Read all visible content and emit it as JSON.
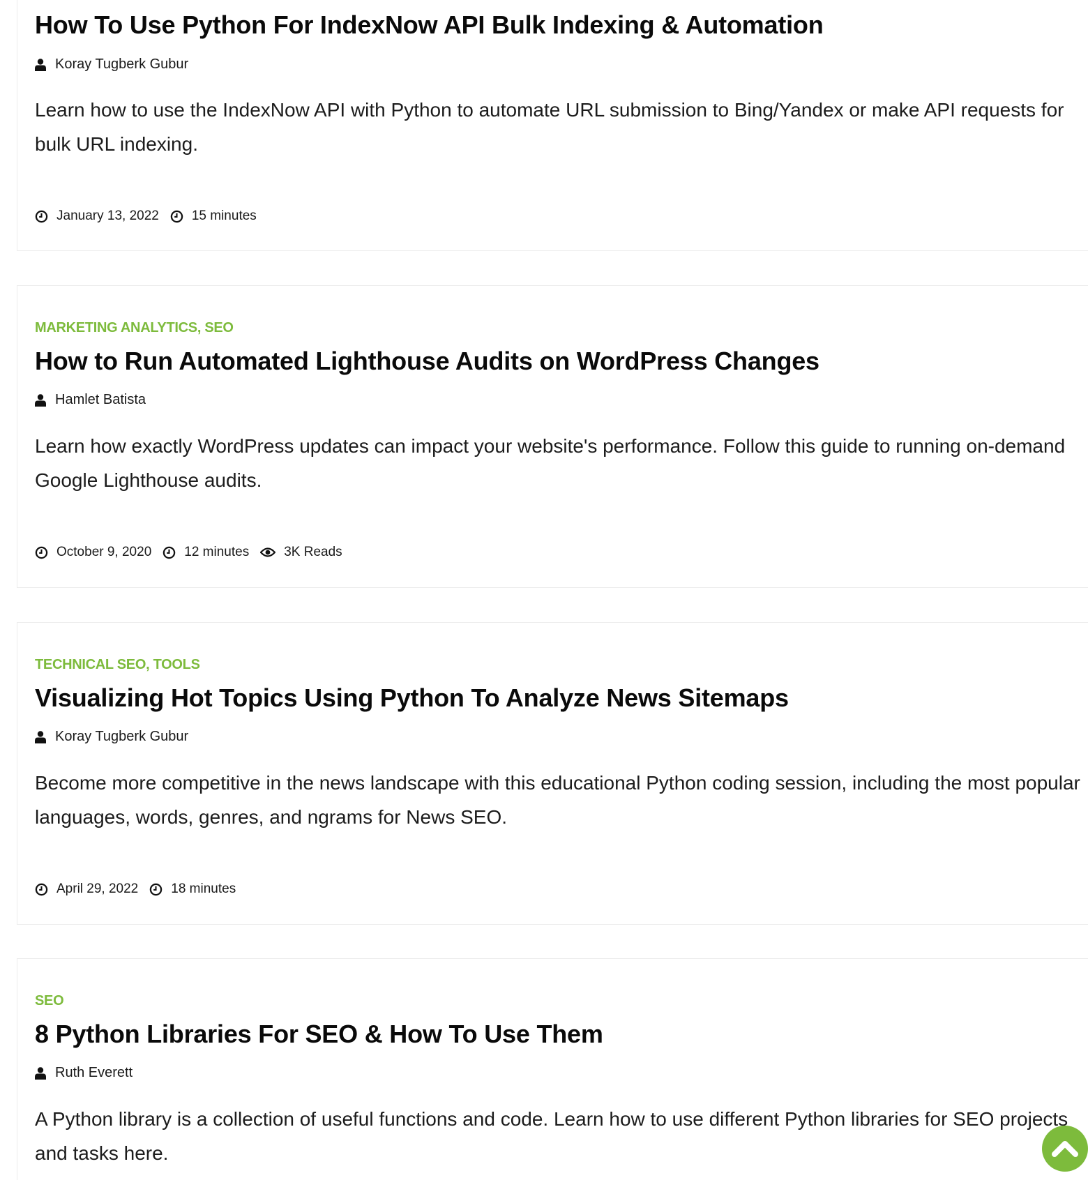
{
  "colors": {
    "accent": "#7dbb3c",
    "text": "#0a0a0a",
    "border": "#ececec"
  },
  "posts": [
    {
      "category": "",
      "title": "How To Use Python For IndexNow API Bulk Indexing & Automation",
      "author": "Koray Tugberk Gubur",
      "excerpt": "Learn how to use the IndexNow API with Python to automate URL submission to Bing/Yandex or make API requests for bulk URL indexing.",
      "date": "January 13, 2022",
      "read_time": "15 minutes",
      "reads": ""
    },
    {
      "category": "MARKETING ANALYTICS, SEO",
      "title": "How to Run Automated Lighthouse Audits on WordPress Changes",
      "author": "Hamlet Batista",
      "excerpt": "Learn how exactly WordPress updates can impact your website's performance. Follow this guide to running on-demand Google Lighthouse audits.",
      "date": "October 9, 2020",
      "read_time": "12 minutes",
      "reads": "3K Reads"
    },
    {
      "category": "TECHNICAL SEO, TOOLS",
      "title": "Visualizing Hot Topics Using Python To Analyze News Sitemaps",
      "author": "Koray Tugberk Gubur",
      "excerpt": "Become more competitive in the news landscape with this educational Python coding session, including the most popular languages, words, genres, and ngrams for News SEO.",
      "date": "April 29, 2022",
      "read_time": "18 minutes",
      "reads": ""
    },
    {
      "category": "SEO",
      "title": "8 Python Libraries For SEO & How To Use Them",
      "author": "Ruth Everett",
      "excerpt": "A Python library is a collection of useful functions and code. Learn how to use different Python libraries for SEO projects and tasks here.",
      "date": "",
      "read_time": "",
      "reads": ""
    }
  ],
  "icons": {
    "author": "user-icon",
    "date": "clock-icon",
    "read_time": "clock-icon",
    "reads": "eye-icon",
    "scroll_top": "chevron-up-icon"
  }
}
